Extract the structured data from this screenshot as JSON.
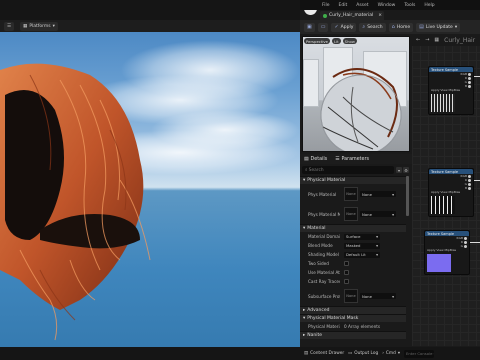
{
  "viewport": {
    "platforms_label": "Platforms"
  },
  "editor": {
    "menu": [
      "File",
      "Edit",
      "Asset",
      "Window",
      "Tools",
      "Help"
    ],
    "asset_tab": "Curly_Hair_material",
    "toolbar": {
      "apply": "Apply",
      "search": "Search",
      "home": "Home",
      "live_update": "Live Update"
    },
    "preview": {
      "perspective": "Perspective",
      "lit": "Lit",
      "show": "Show"
    },
    "details_tabs": {
      "details": "Details",
      "parameters": "Parameters"
    },
    "details_search_placeholder": "Search",
    "sections": {
      "physical_material": "Physical Material",
      "material": "Material",
      "advanced": "Advanced",
      "physical_material_mask": "Physical Material Mask",
      "nanite": "Nanite"
    },
    "rows": {
      "phys_mat": {
        "label": "Phys Material",
        "value": "None"
      },
      "phys_mat_mask": {
        "label": "Phys Material Mask",
        "value": "None"
      },
      "material_domain": {
        "label": "Material Domain",
        "value": "Surface"
      },
      "blend_mode": {
        "label": "Blend Mode",
        "value": "Masked"
      },
      "shading_model": {
        "label": "Shading Model",
        "value": "Default Lit"
      },
      "two_sided": {
        "label": "Two Sided"
      },
      "use_material_attrs": {
        "label": "Use Material Attri..."
      },
      "cast_ray_traced": {
        "label": "Cast Ray Traced..."
      },
      "subsurface_profile": {
        "label": "Subsurface Profi...",
        "value": "None"
      },
      "phys_mat_summary": {
        "label": "Physical Material",
        "value": "0 Array elements"
      }
    },
    "graph": {
      "title": "Curly_Hair",
      "node_label": "Texture Sample",
      "pins": [
        "RGB",
        "R",
        "G",
        "B",
        "A",
        "RGBA"
      ],
      "uv_label": "Apply View MipBias"
    },
    "statusbar": {
      "content_drawer": "Content Drawer",
      "output_log": "Output Log",
      "cmd": "Cmd",
      "cmd_placeholder": "Enter Console Command"
    }
  },
  "colors": {
    "accent_green": "#3fae4a",
    "node_header": "#27507a",
    "hair": "#c0552a"
  }
}
